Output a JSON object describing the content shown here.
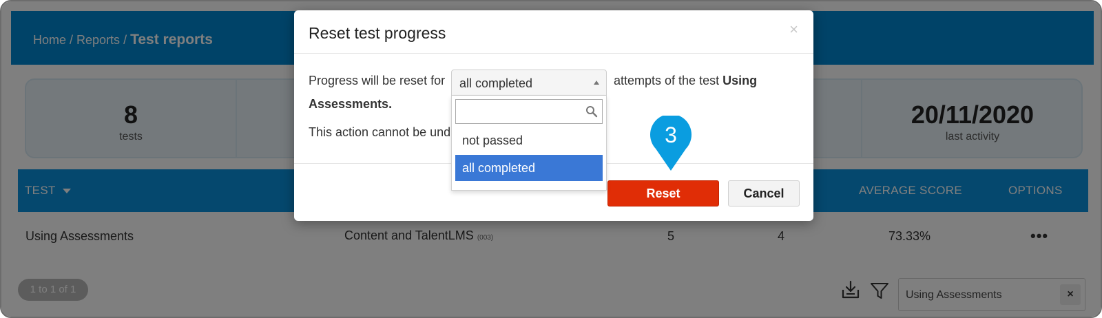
{
  "breadcrumb": {
    "home": "Home",
    "reports": "Reports",
    "sep": "/",
    "current": "Test reports"
  },
  "stats": [
    {
      "value": "8",
      "label": "tests"
    },
    {
      "value": "20/11/2020",
      "label": "last activity"
    }
  ],
  "table": {
    "headers": {
      "test": "TEST",
      "average_score": "AVERAGE SCORE",
      "options": "OPTIONS"
    },
    "row": {
      "test": "Using Assessments",
      "course": "Content and TalentLMS",
      "course_code": "(003)",
      "col3": "5",
      "col4": "4",
      "average_score": "73.33%",
      "options": "•••"
    }
  },
  "pager": "1 to 1 of 1",
  "search": {
    "value": "Using Assessments",
    "clear": "×"
  },
  "modal": {
    "title": "Reset test progress",
    "close": "×",
    "text_before": "Progress will be reset for",
    "text_after": "attempts of the test",
    "test_name_1": "Using",
    "test_name_2": "Assessments.",
    "warning": "This action cannot be und",
    "select_value": "all completed",
    "options": [
      "not passed",
      "all completed"
    ],
    "reset_label": "Reset",
    "cancel_label": "Cancel"
  },
  "step_marker": "3",
  "colors": {
    "header": "#0087d0",
    "table_head": "#0a90dd",
    "reset": "#e02d06",
    "option_selected": "#3a78d6",
    "pin": "#0a9de0"
  }
}
